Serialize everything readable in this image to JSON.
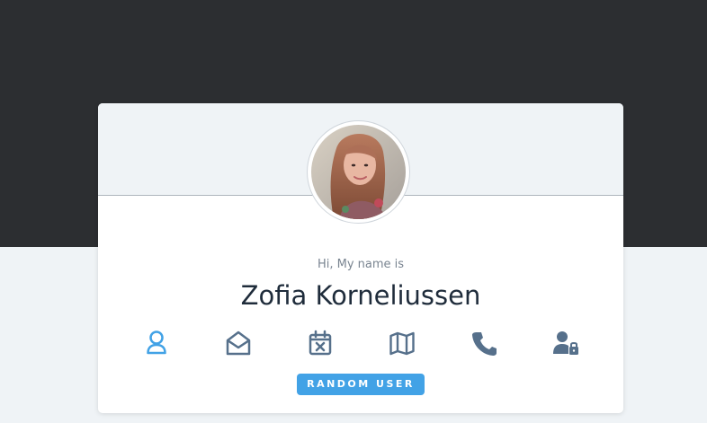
{
  "colors": {
    "background_top": "#2c2e31",
    "background_bottom": "#eff3f6",
    "card": "#ffffff",
    "icon_active": "#42a2e6",
    "icon_default": "#56708b",
    "button": "#42a2e6",
    "button_text": "#ffffff"
  },
  "profile": {
    "greeting": "Hi, My name is",
    "name": "Zofia Korneliussen"
  },
  "icons": [
    {
      "name": "user-icon",
      "state": "active"
    },
    {
      "name": "envelope-open-icon",
      "state": "default"
    },
    {
      "name": "calendar-x-icon",
      "state": "default"
    },
    {
      "name": "map-icon",
      "state": "default"
    },
    {
      "name": "phone-icon",
      "state": "default"
    },
    {
      "name": "user-lock-icon",
      "state": "default"
    }
  ],
  "actions": {
    "random_user_label": "RANDOM USER"
  }
}
